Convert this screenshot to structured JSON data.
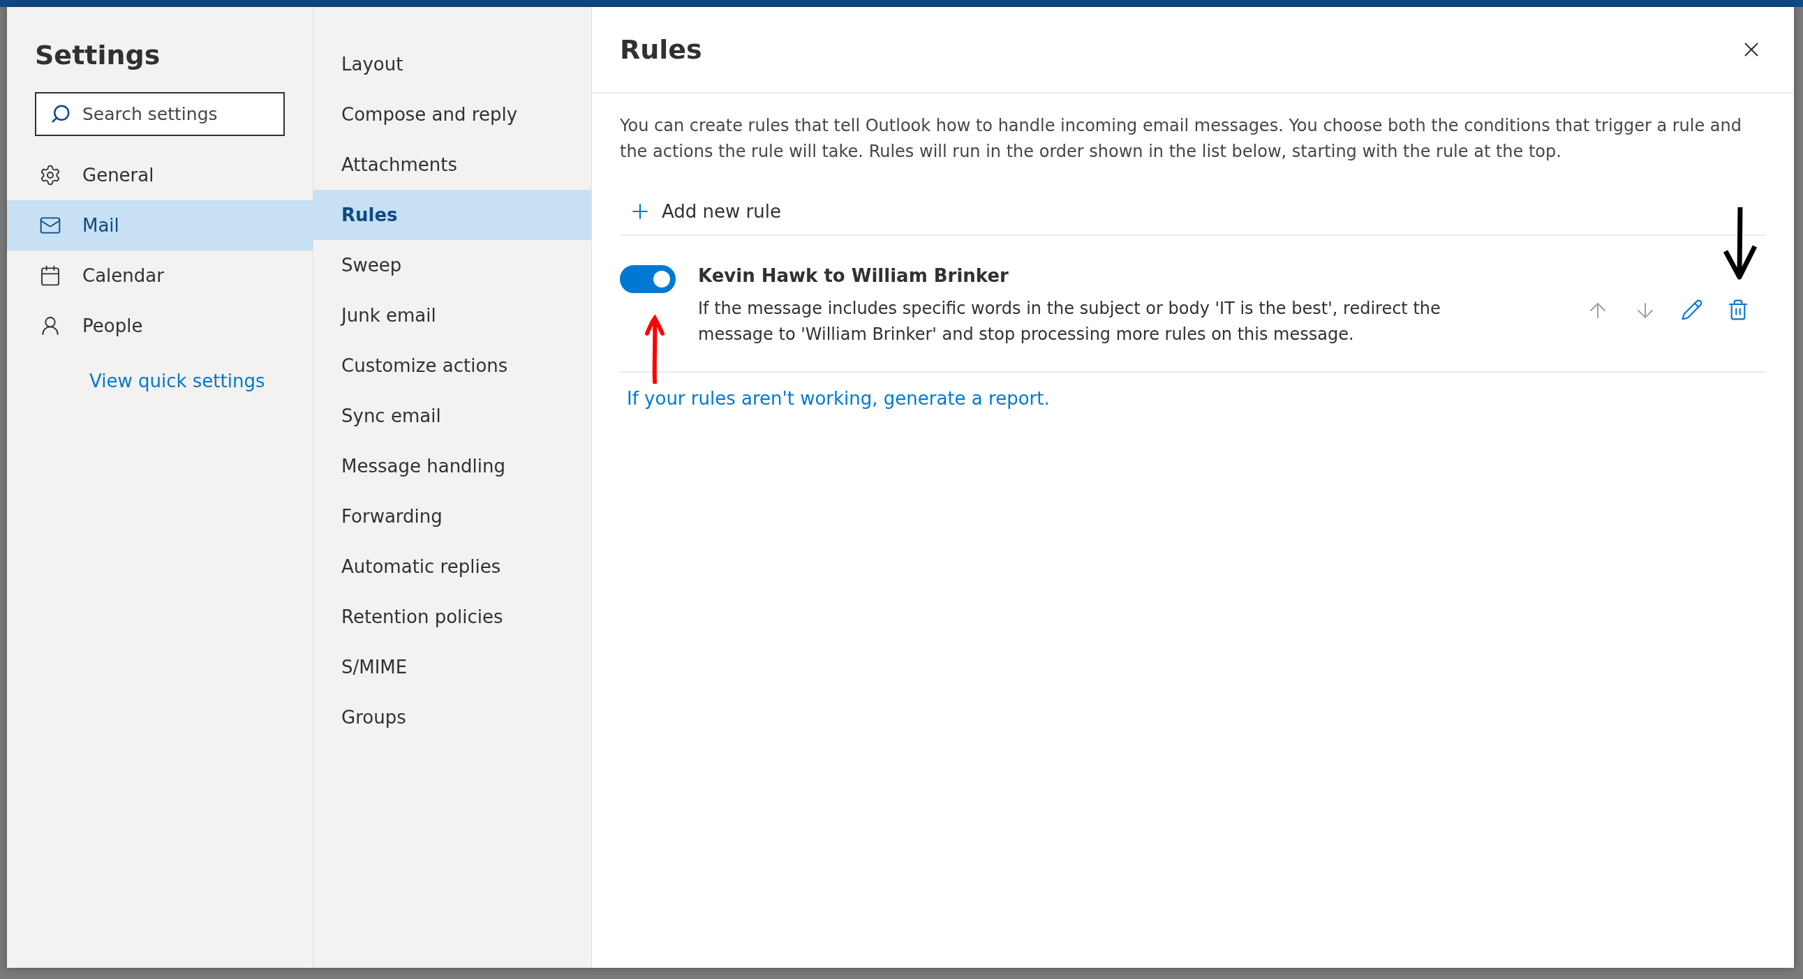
{
  "title": "Settings",
  "search": {
    "placeholder": "Search settings"
  },
  "categories": [
    {
      "label": "General",
      "selected": false
    },
    {
      "label": "Mail",
      "selected": true
    },
    {
      "label": "Calendar",
      "selected": false
    },
    {
      "label": "People",
      "selected": false
    }
  ],
  "quick_settings_link": "View quick settings",
  "subcategories": [
    {
      "label": "Layout",
      "selected": false
    },
    {
      "label": "Compose and reply",
      "selected": false
    },
    {
      "label": "Attachments",
      "selected": false
    },
    {
      "label": "Rules",
      "selected": true
    },
    {
      "label": "Sweep",
      "selected": false
    },
    {
      "label": "Junk email",
      "selected": false
    },
    {
      "label": "Customize actions",
      "selected": false
    },
    {
      "label": "Sync email",
      "selected": false
    },
    {
      "label": "Message handling",
      "selected": false
    },
    {
      "label": "Forwarding",
      "selected": false
    },
    {
      "label": "Automatic replies",
      "selected": false
    },
    {
      "label": "Retention policies",
      "selected": false
    },
    {
      "label": "S/MIME",
      "selected": false
    },
    {
      "label": "Groups",
      "selected": false
    }
  ],
  "panel": {
    "title": "Rules",
    "description": "You can create rules that tell Outlook how to handle incoming email messages. You choose both the conditions that trigger a rule and the actions the rule will take. Rules will run in the order shown in the list below, starting with the rule at the top.",
    "add_button": "Add new rule",
    "rules": [
      {
        "name": "Kevin Hawk to William Brinker",
        "description": "If the message includes specific words in the subject or body 'IT is the best', redirect the message to 'William Brinker' and stop processing more rules on this message.",
        "enabled": true,
        "move_up_disabled": true,
        "move_down_disabled": true
      }
    ],
    "report_link": "If your rules aren't working, generate a report."
  }
}
